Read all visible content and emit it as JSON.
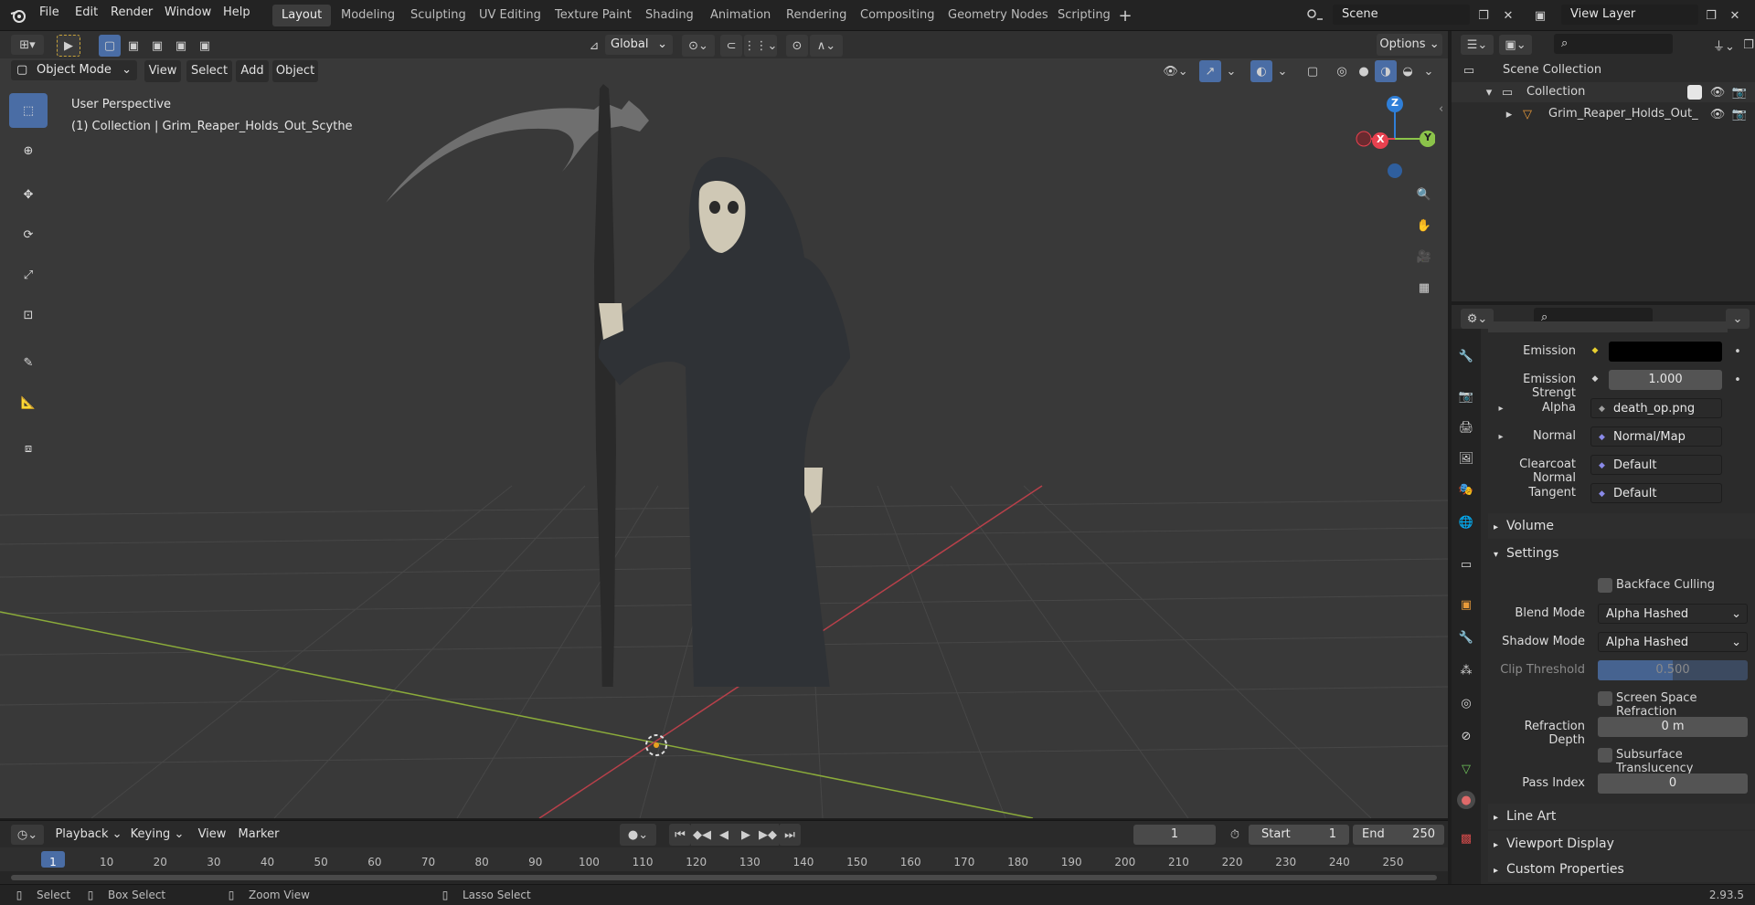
{
  "menu": {
    "items": [
      "File",
      "Edit",
      "Render",
      "Window",
      "Help"
    ]
  },
  "workspaces": {
    "tabs": [
      "Layout",
      "Modeling",
      "Sculpting",
      "UV Editing",
      "Texture Paint",
      "Shading",
      "Animation",
      "Rendering",
      "Compositing",
      "Geometry Nodes",
      "Scripting"
    ],
    "active": "Layout"
  },
  "scene": {
    "name": "Scene",
    "view_layer": "View Layer"
  },
  "viewport_header": {
    "mode": "Object Mode",
    "menus": [
      "View",
      "Select",
      "Add",
      "Object"
    ],
    "transform_orientation": "Global",
    "options": "Options"
  },
  "viewport": {
    "perspective": "User Perspective",
    "context": "(1) Collection | Grim_Reaper_Holds_Out_Scythe",
    "gizmo": {
      "x": "X",
      "y": "Y",
      "z": "Z"
    }
  },
  "outliner": {
    "root": "Scene Collection",
    "collection": "Collection",
    "object": "Grim_Reaper_Holds_Out_"
  },
  "properties": {
    "rows": [
      {
        "label": "Emission",
        "value": ""
      },
      {
        "label": "Emission Strengt",
        "value": "1.000"
      },
      {
        "label": "Alpha",
        "value": "death_op.png"
      },
      {
        "label": "Normal",
        "value": "Normal/Map"
      },
      {
        "label": "Clearcoat Normal",
        "value": "Default"
      },
      {
        "label": "Tangent",
        "value": "Default"
      }
    ],
    "panels": {
      "volume": "Volume",
      "settings": "Settings",
      "line_art": "Line Art",
      "viewport_display": "Viewport Display",
      "custom_properties": "Custom Properties"
    },
    "settings": {
      "backface_culling": "Backface Culling",
      "blend_mode_label": "Blend Mode",
      "blend_mode": "Alpha Hashed",
      "shadow_mode_label": "Shadow Mode",
      "shadow_mode": "Alpha Hashed",
      "clip_threshold_label": "Clip Threshold",
      "clip_threshold": "0.500",
      "ssr": "Screen Space Refraction",
      "refraction_depth_label": "Refraction Depth",
      "refraction_depth": "0 m",
      "subsurface": "Subsurface Translucency",
      "pass_index_label": "Pass Index",
      "pass_index": "0"
    }
  },
  "timeline": {
    "menus": [
      "Playback",
      "Keying",
      "View",
      "Marker"
    ],
    "current_frame": "1",
    "start_label": "Start",
    "start": "1",
    "end_label": "End",
    "end": "250",
    "ruler": [
      "1",
      "10",
      "20",
      "30",
      "40",
      "50",
      "60",
      "70",
      "80",
      "90",
      "100",
      "110",
      "120",
      "130",
      "140",
      "150",
      "160",
      "170",
      "180",
      "190",
      "200",
      "210",
      "220",
      "230",
      "240",
      "250"
    ]
  },
  "status": {
    "select": "Select",
    "box_select": "Box Select",
    "zoom_view": "Zoom View",
    "lasso_select": "Lasso Select",
    "version": "2.93.5"
  },
  "colors": {
    "accent": "#4a6da5",
    "x_axis": "#e8414f",
    "y_axis": "#8bc34a",
    "z_axis": "#2f7fd8"
  }
}
